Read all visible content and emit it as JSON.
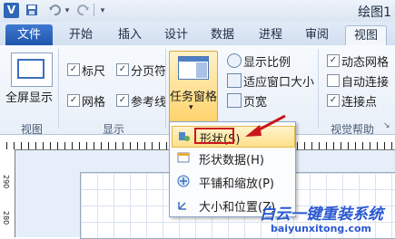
{
  "titlebar": {
    "app_icon": "V",
    "title": "绘图1",
    "icons": [
      "save-icon",
      "undo-icon",
      "redo-icon"
    ]
  },
  "tabs": {
    "file": "文件",
    "items": [
      "开始",
      "插入",
      "设计",
      "数据",
      "进程",
      "审阅",
      "视图"
    ],
    "active": "视图"
  },
  "ribbon": {
    "fullscreen_label": "全屏显示",
    "view_group_label": "视图",
    "show_group": {
      "label": "显示",
      "checks": [
        {
          "label": "标尺",
          "checked": true
        },
        {
          "label": "分页符",
          "checked": true
        },
        {
          "label": "网格",
          "checked": true
        },
        {
          "label": "参考线",
          "checked": true
        }
      ]
    },
    "taskpane_label": "任务窗格",
    "zoom_items": [
      "显示比例",
      "适应窗口大小",
      "页宽"
    ],
    "visual_aids": {
      "label": "视觉帮助",
      "checks": [
        {
          "label": "动态网格",
          "checked": true
        },
        {
          "label": "自动连接",
          "checked": false
        },
        {
          "label": "连接点",
          "checked": true
        }
      ]
    }
  },
  "ruler": {
    "left_marks": [
      "290",
      "280"
    ]
  },
  "menu": {
    "items": [
      {
        "label": "形状(S)",
        "icon": "shapes-icon",
        "highlighted": true
      },
      {
        "label": "形状数据(H)",
        "icon": "shape-data-icon",
        "highlighted": false
      },
      {
        "label": "平铺和缩放(P)",
        "icon": "pan-zoom-icon",
        "highlighted": false
      },
      {
        "label": "大小和位置(Z)",
        "icon": "size-position-icon",
        "highlighted": false
      }
    ]
  },
  "watermark": {
    "text": "白云一键重装系统",
    "url": "baiyunxitong.com"
  },
  "colors": {
    "file_tab": "#2a62be",
    "highlight_border": "#c9171c",
    "arrow": "#c9171c",
    "selected_button": "#ffd36b",
    "watermark": "#2a58d0"
  }
}
